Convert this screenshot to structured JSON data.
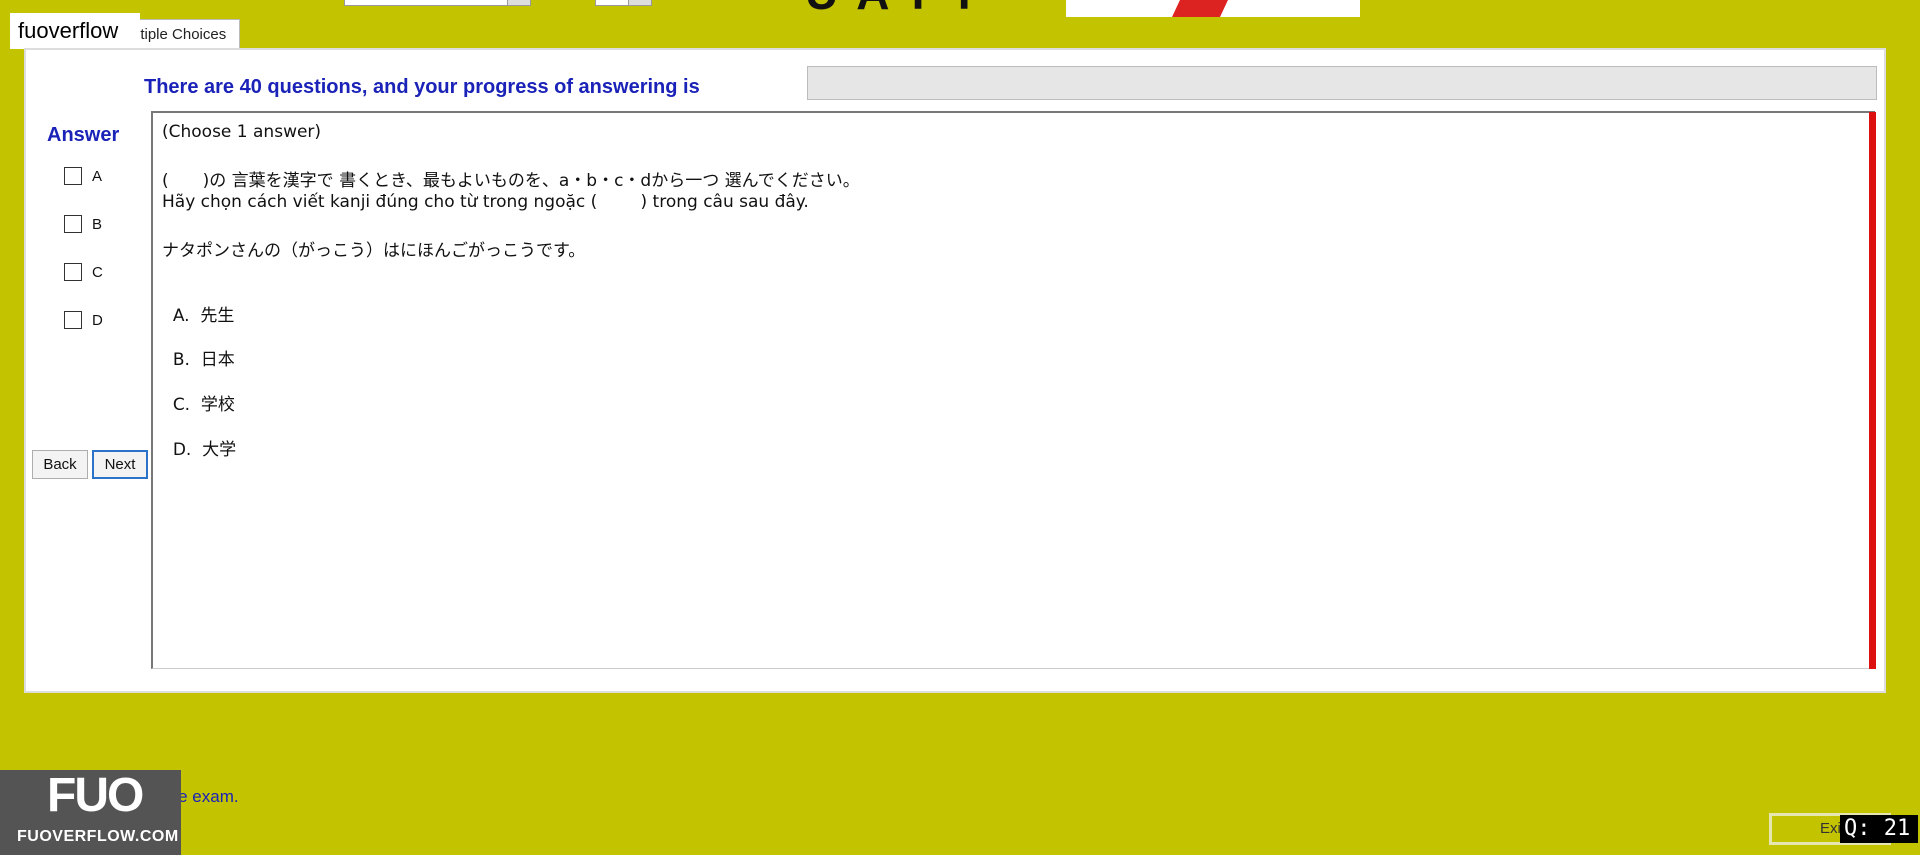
{
  "tab": {
    "label": "ltiple Choices"
  },
  "watermark": {
    "label": "fuoverflow"
  },
  "header": {
    "heading_fragment": "UATT"
  },
  "progress": {
    "label": "There are 40 questions, and your progress of answering is",
    "fraction": 0.0
  },
  "answer_panel": {
    "title": "Answer",
    "options": [
      "A",
      "B",
      "C",
      "D"
    ],
    "back_label": "Back",
    "next_label": "Next"
  },
  "question": {
    "instruction": "(Choose 1 answer)",
    "prompt_jp": "(　　)の 言葉を漢字で 書くとき、最もよいものを、a・b・c・dから一つ 選んでください。",
    "prompt_vi": "Hãy chọn cách viết kanji đúng cho từ trong ngoặc (        ) trong câu sau đây.",
    "sentence": "ナタポンさんの（がっこう）はにほんごがっこうです。",
    "choices": [
      {
        "letter": "A.",
        "text": "先生"
      },
      {
        "letter": "B.",
        "text": "日本"
      },
      {
        "letter": "C.",
        "text": "学校"
      },
      {
        "letter": "D.",
        "text": "大学"
      }
    ]
  },
  "footer": {
    "finish_label": "I want to finish the exam.",
    "finish_visible_label": "want to finish the exam.",
    "exit_label": "Exit",
    "counter": "Q: 21"
  },
  "logo": {
    "big_text": "FUO",
    "small_text": "FUOVERFLOW.COM"
  },
  "colors": {
    "background": "#c3c300",
    "accent_text": "#1a22b8",
    "scroll_marker": "#dd1010"
  }
}
